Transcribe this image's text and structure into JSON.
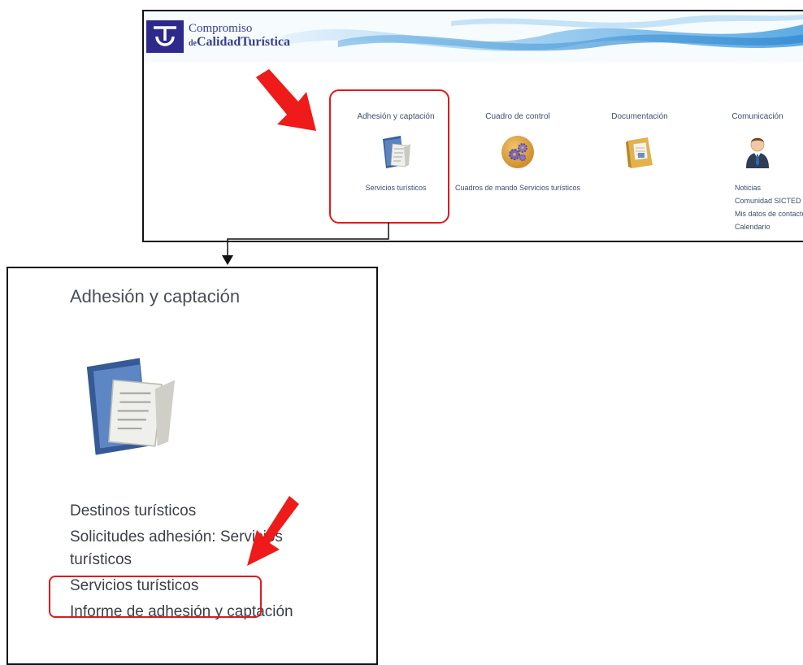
{
  "brand": {
    "line1": "Compromiso",
    "line2_prefix": "de",
    "line2": "CalidadTurística"
  },
  "columns": [
    {
      "title": "Adhesión y captación",
      "links": [
        "Servicios turísticos"
      ]
    },
    {
      "title": "Cuadro de control",
      "links": [
        "Cuadros de mando Servicios turísticos"
      ]
    },
    {
      "title": "Documentación",
      "links": []
    },
    {
      "title": "Comunicación",
      "links": [
        "Noticias",
        "Comunidad SICTED",
        "Mis datos de contacto",
        "Calendario"
      ]
    }
  ],
  "zoom": {
    "title": "Adhesión y captación",
    "items": [
      "Destinos turísticos",
      "Solicitudes adhesión: Servicios turísticos",
      "Servicios turísticos",
      "Informe de adhesión y captación"
    ]
  },
  "colors": {
    "accent_red": "#e0191e",
    "brand_blue": "#2e2a8c",
    "link_text": "#3d4e6b"
  },
  "icons": [
    "folder-documents-icon",
    "gears-icon",
    "documents-box-icon",
    "user-tie-icon"
  ]
}
